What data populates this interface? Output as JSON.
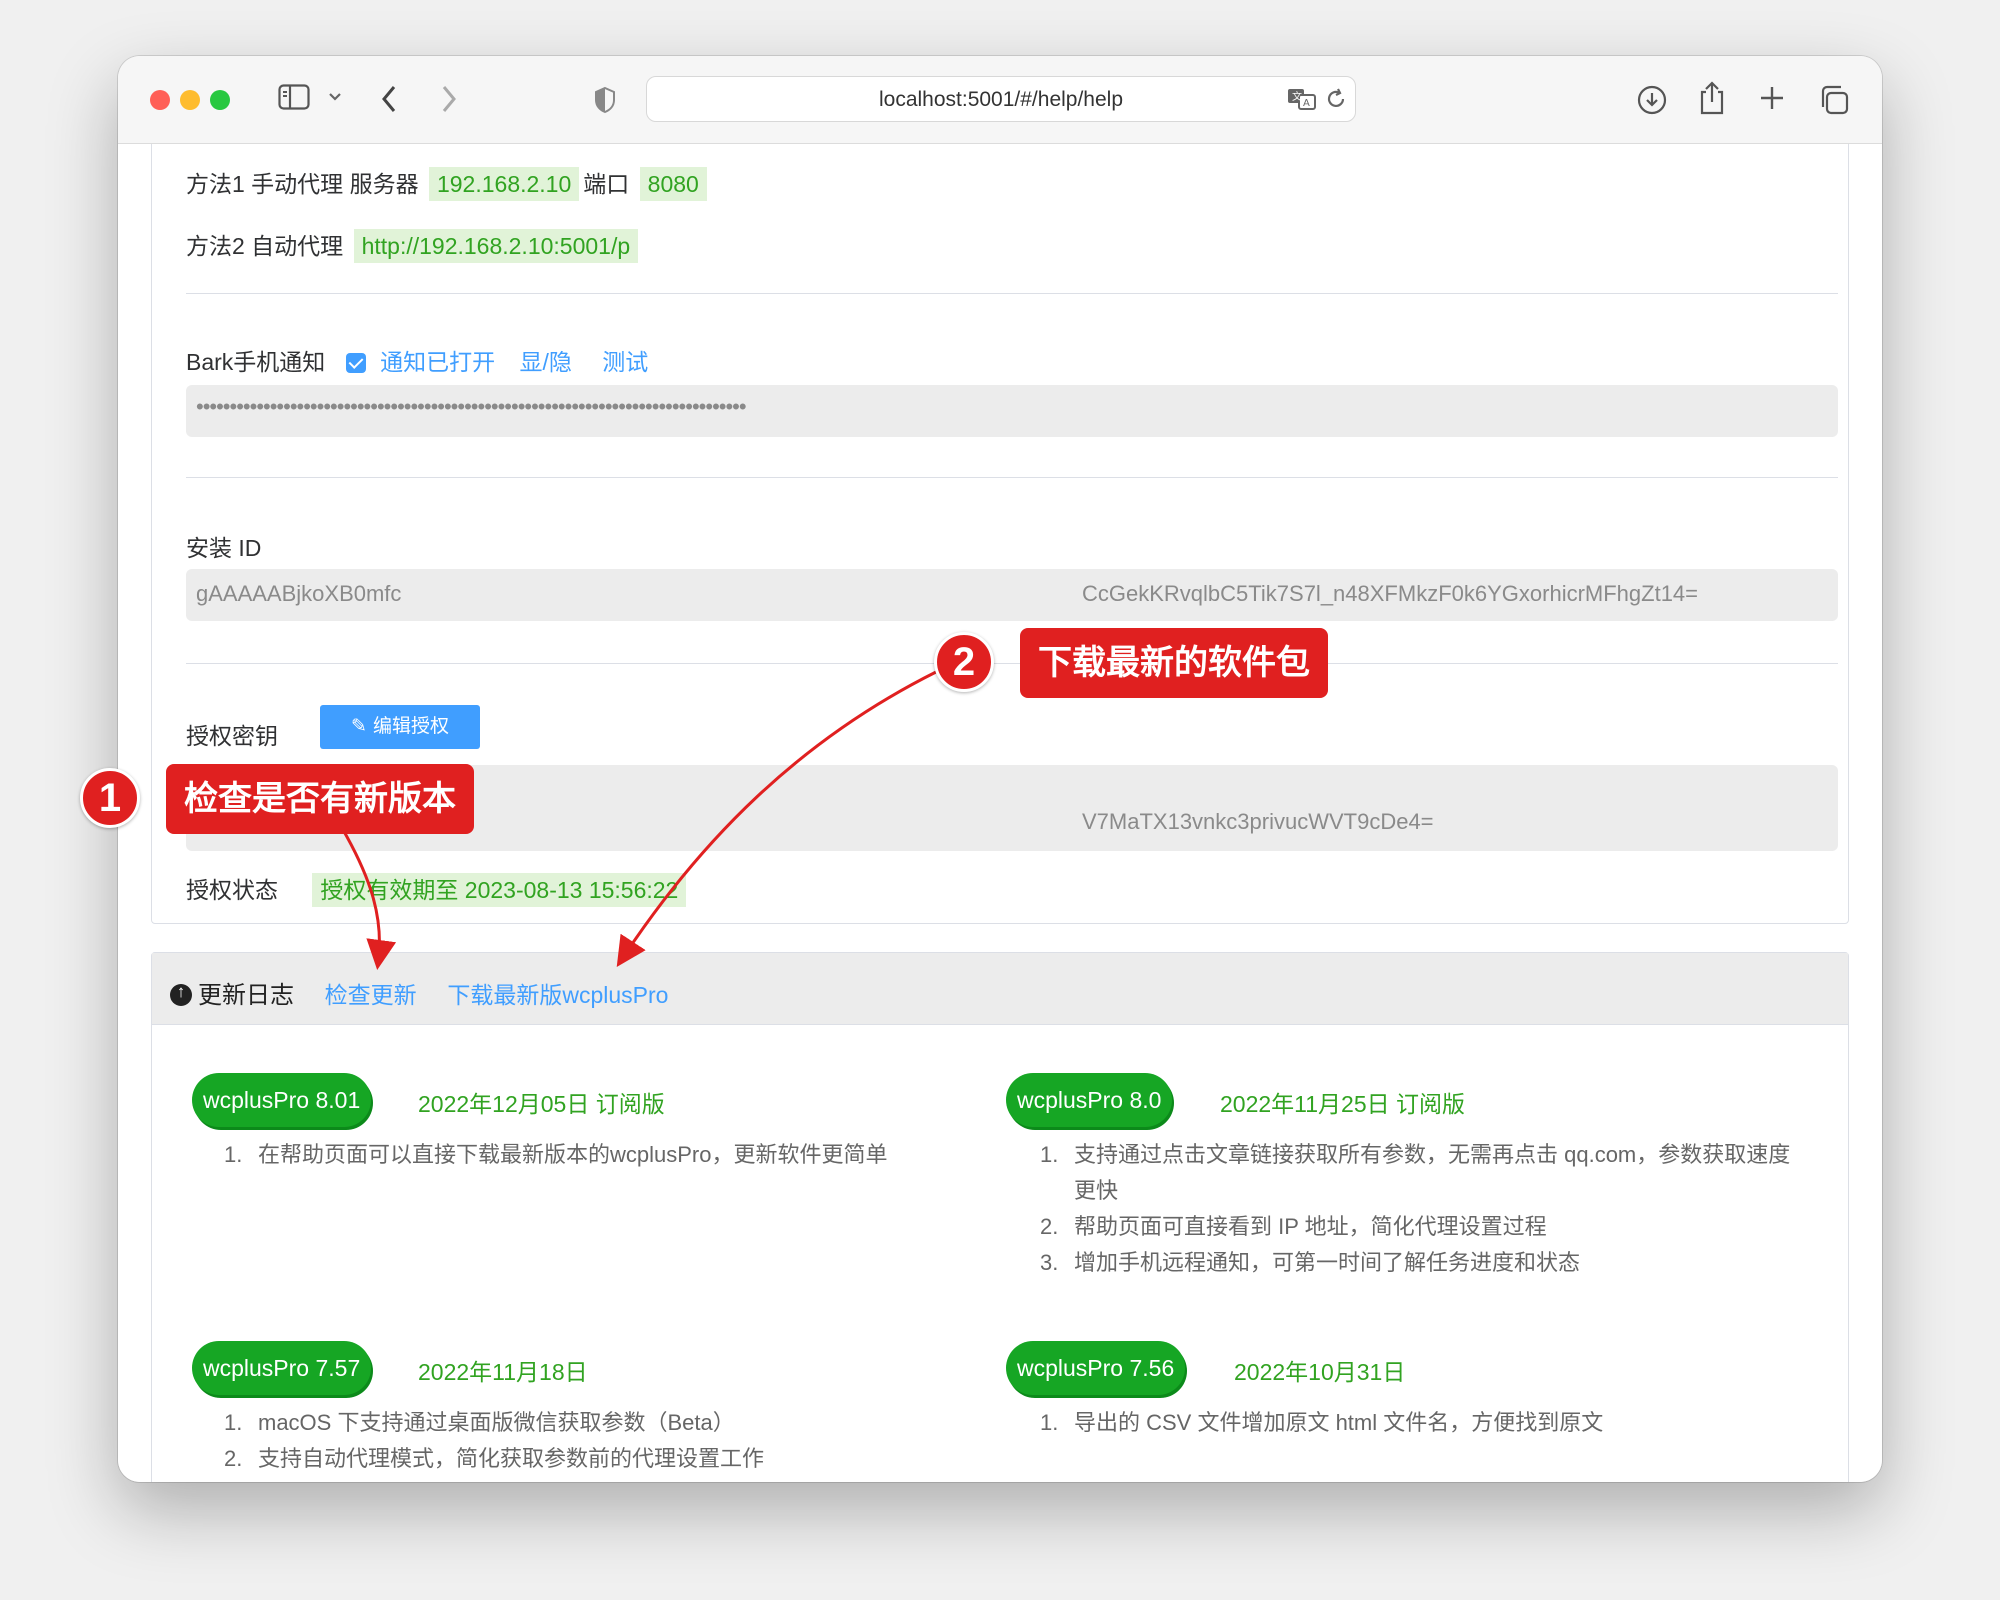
{
  "browser": {
    "url": "localhost:5001/#/help/help"
  },
  "proxy": {
    "method1_label": "方法1 手动代理 服务器",
    "server": "192.168.2.10",
    "port_label": "端口",
    "port": "8080",
    "method2_label": "方法2 自动代理",
    "pac_url": "http://192.168.2.10:5001/p"
  },
  "bark": {
    "label": "Bark手机通知",
    "enabled_label": "通知已打开",
    "toggle_label": "显/隐",
    "test_label": "测试",
    "key_masked": "••••••••••••••••••••••••••••••••••••••••••••••••••••••••••••••••••••••••••••••••••"
  },
  "install": {
    "label": "安装 ID",
    "id_start": "gAAAAABjkoXB0mfc",
    "id_end": "CcGekKRvqlbC5Tik7S7l_n48XFMkzF0k6YGxorhicrMFhgZt14="
  },
  "license": {
    "label": "授权密钥",
    "edit_button": "编辑授权",
    "key_end": "V7MaTX13vnkc3privucWVT9cDe4=",
    "status_label": "授权状态",
    "status_value": "授权有效期至 2023-08-13 15:56:22"
  },
  "changelog": {
    "title": "更新日志",
    "check_update": "检查更新",
    "download_latest": "下载最新版wcplusPro",
    "releases": [
      {
        "version": "wcplusPro 8.01",
        "date": "2022年12月05日 订阅版",
        "notes": [
          "在帮助页面可以直接下载最新版本的wcplusPro，更新软件更简单"
        ]
      },
      {
        "version": "wcplusPro 8.0",
        "date": "2022年11月25日 订阅版",
        "notes": [
          "支持通过点击文章链接获取所有参数，无需再点击 qq.com，参数获取速度更快",
          "帮助页面可直接看到 IP 地址，简化代理设置过程",
          "增加手机远程通知，可第一时间了解任务进度和状态"
        ]
      },
      {
        "version": "wcplusPro 7.57",
        "date": "2022年11月18日",
        "notes": [
          "macOS 下支持通过桌面版微信获取参数（Beta）",
          "支持自动代理模式，简化获取参数前的代理设置工作"
        ]
      },
      {
        "version": "wcplusPro 7.56",
        "date": "2022年10月31日",
        "notes": [
          "导出的 CSV 文件增加原文 html 文件名，方便找到原文"
        ]
      }
    ]
  },
  "annotations": [
    {
      "number": "1",
      "label": "检查是否有新版本"
    },
    {
      "number": "2",
      "label": "下载最新的软件包"
    }
  ],
  "colors": {
    "accent": "#409eff",
    "green_tag_bg": "#e1f3d8",
    "green_text": "#31a321",
    "version_pill": "#16a624",
    "callout_red": "#e02020"
  }
}
